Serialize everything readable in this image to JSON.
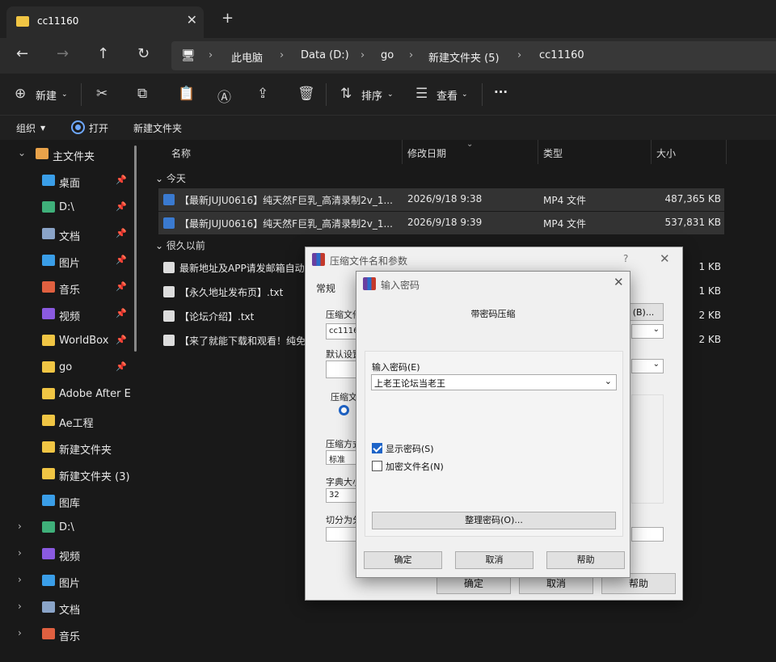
{
  "tab": {
    "title": "cc11160"
  },
  "nav": {
    "breadcrumb": [
      "此电脑",
      "Data (D:)",
      "go",
      "新建文件夹 (5)",
      "cc11160"
    ]
  },
  "toolbar": {
    "new_label": "新建",
    "sort_label": "排序",
    "view_label": "查看",
    "more": "···"
  },
  "subbar": {
    "organize": "组织",
    "open": "打开",
    "new_folder": "新建文件夹"
  },
  "sidebar": {
    "items": [
      {
        "label": "主文件夹",
        "icon": "home-icon",
        "color": "#e8a24a",
        "chev": "⌄",
        "pin": ""
      },
      {
        "label": "桌面",
        "icon": "desktop-icon",
        "color": "#3a9ee8",
        "chev": "",
        "pin": "📌"
      },
      {
        "label": "D:\\",
        "icon": "download-icon",
        "color": "#3fb07a",
        "chev": "",
        "pin": "📌"
      },
      {
        "label": "文档",
        "icon": "document-icon",
        "color": "#8aa4c8",
        "chev": "",
        "pin": "📌"
      },
      {
        "label": "图片",
        "icon": "picture-icon",
        "color": "#3a9ee8",
        "chev": "",
        "pin": "📌"
      },
      {
        "label": "音乐",
        "icon": "music-icon",
        "color": "#e06040",
        "chev": "",
        "pin": "📌"
      },
      {
        "label": "视频",
        "icon": "video-icon",
        "color": "#8a5ae0",
        "chev": "",
        "pin": "📌"
      },
      {
        "label": "WorldBox",
        "icon": "folder-icon",
        "color": "#f0c544",
        "chev": "",
        "pin": "📌"
      },
      {
        "label": "go",
        "icon": "folder-icon",
        "color": "#f0c544",
        "chev": "",
        "pin": "📌"
      },
      {
        "label": "Adobe After E",
        "icon": "folder-icon",
        "color": "#f0c544",
        "chev": "",
        "pin": ""
      },
      {
        "label": "Ae工程",
        "icon": "folder-icon",
        "color": "#f0c544",
        "chev": "",
        "pin": ""
      },
      {
        "label": "新建文件夹",
        "icon": "folder-icon",
        "color": "#f0c544",
        "chev": "",
        "pin": ""
      },
      {
        "label": "新建文件夹 (3)",
        "icon": "folder-icon",
        "color": "#f0c544",
        "chev": "",
        "pin": ""
      },
      {
        "label": "图库",
        "icon": "gallery-icon",
        "color": "#3a9ee8",
        "chev": "",
        "pin": ""
      },
      {
        "label": "D:\\",
        "icon": "download-icon",
        "color": "#3fb07a",
        "chev": "›",
        "pin": ""
      },
      {
        "label": "视频",
        "icon": "video-icon",
        "color": "#8a5ae0",
        "chev": "›",
        "pin": ""
      },
      {
        "label": "图片",
        "icon": "picture-icon",
        "color": "#3a9ee8",
        "chev": "›",
        "pin": ""
      },
      {
        "label": "文档",
        "icon": "document-icon",
        "color": "#8aa4c8",
        "chev": "›",
        "pin": ""
      },
      {
        "label": "音乐",
        "icon": "music-icon",
        "color": "#e06040",
        "chev": "›",
        "pin": ""
      }
    ]
  },
  "files": {
    "columns": [
      "名称",
      "修改日期",
      "类型",
      "大小"
    ],
    "groups": [
      "今天",
      "很久以前"
    ],
    "rows": [
      {
        "name": "【最新JUJU0616】纯天然F巨乳_高清录制2v_1...",
        "date": "2026/9/18 9:38",
        "type": "MP4 文件",
        "size": "487,365 KB",
        "icon": "#3a7ad0",
        "selected": true
      },
      {
        "name": "【最新JUJU0616】纯天然F巨乳_高清录制2v_1...",
        "date": "2026/9/18 9:39",
        "type": "MP4 文件",
        "size": "537,831 KB",
        "icon": "#3a7ad0",
        "selected": true
      },
      {
        "name": "最新地址及APP请发邮箱自动",
        "date": "",
        "type": "",
        "size": "1 KB",
        "icon": "#dddddd",
        "selected": false
      },
      {
        "name": "【永久地址发布页】.txt",
        "date": "",
        "type": "",
        "size": "1 KB",
        "icon": "#dddddd",
        "selected": false
      },
      {
        "name": "【论坛介绍】.txt",
        "date": "",
        "type": "",
        "size": "2 KB",
        "icon": "#dddddd",
        "selected": false
      },
      {
        "name": "【来了就能下载和观看！纯免",
        "date": "",
        "type": "",
        "size": "2 KB",
        "icon": "#dddddd",
        "selected": false
      }
    ]
  },
  "archive_dialog": {
    "title": "压缩文件名和参数",
    "help": "?",
    "close": "✕",
    "tab_general": "常规",
    "label_filename": "压缩文件",
    "filename_value": "cc1116",
    "label_profile": "默认设置",
    "label_format": "压缩文件",
    "label_method": "压缩方式",
    "method_value": "标准",
    "label_dict": "字典大小",
    "dict_value": "32",
    "label_split": "切分为分卷",
    "browse": "(B)...",
    "ok": "确定",
    "cancel": "取消",
    "help_btn": "帮助"
  },
  "password_dialog": {
    "title": "输入密码",
    "heading": "带密码压缩",
    "label_password": "输入密码(E)",
    "password_value": "上老王论坛当老王",
    "show_password": "显示密码(S)",
    "show_checked": true,
    "encrypt_names": "加密文件名(N)",
    "encrypt_checked": false,
    "organize": "整理密码(O)...",
    "ok": "确定",
    "cancel": "取消",
    "help": "帮助",
    "close": "✕"
  }
}
